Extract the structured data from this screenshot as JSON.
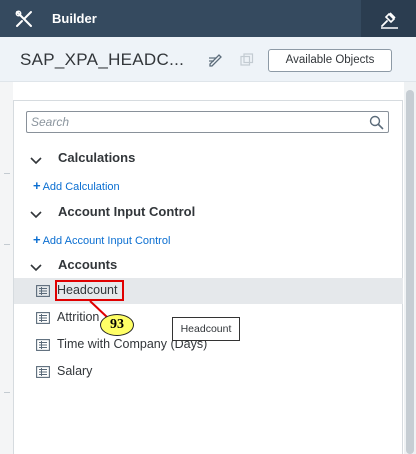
{
  "app": {
    "title": "Builder",
    "icons": {
      "tools": "tools-icon",
      "pin": "pin-icon"
    }
  },
  "model": {
    "name": "SAP_XPA_HEADC...",
    "edit_icon": "edit-icon",
    "copy_icon": "copy-icon",
    "available_objects_label": "Available Objects"
  },
  "search": {
    "placeholder": "Search",
    "value": ""
  },
  "sections": {
    "calculations": {
      "label": "Calculations",
      "add_label": "Add Calculation"
    },
    "account_input_control": {
      "label": "Account Input Control",
      "add_label": "Add Account Input Control"
    },
    "accounts": {
      "label": "Accounts",
      "items": [
        {
          "label": "Headcount",
          "selected": true
        },
        {
          "label": "Attrition",
          "selected": false
        },
        {
          "label": "Time with Company (Days)",
          "selected": false
        },
        {
          "label": "Salary",
          "selected": false
        }
      ]
    }
  },
  "annotation": {
    "badge_number": "93",
    "tooltip_text": "Headcount",
    "highlight_color": "#e00000",
    "badge_color": "#ffff66"
  },
  "colors": {
    "shell_bar": "#354a5f",
    "subheader_bg": "#eef3f8",
    "link": "#0a6ed1",
    "selected_row": "#e5e8eb"
  }
}
